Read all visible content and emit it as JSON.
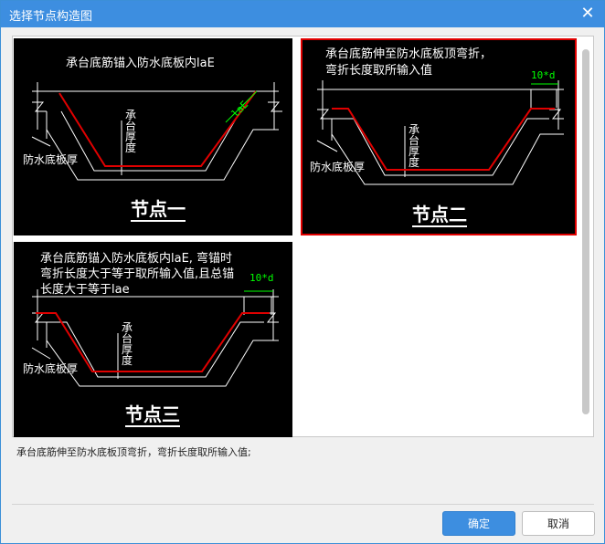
{
  "window": {
    "title": "选择节点构造图",
    "close_glyph": "✕"
  },
  "tiles": [
    {
      "caption_lines": [
        "承台底筋锚入防水底板内laE"
      ],
      "dim_label": "laE",
      "thickness_label": "承台厚度",
      "side_label": "防水底板厚",
      "node_label": "节点一",
      "selected": false
    },
    {
      "caption_lines": [
        "承台底筋伸至防水底板顶弯折，",
        "弯折长度取所输入值"
      ],
      "dim_label": "10*d",
      "thickness_label": "承台厚度",
      "side_label": "防水底板厚",
      "node_label": "节点二",
      "selected": true
    },
    {
      "caption_lines": [
        "承台底筋锚入防水底板内laE, 弯锚时",
        "弯折长度大于等于取所输入值,且总锚",
        "长度大于等于lae"
      ],
      "dim_label": "10*d",
      "thickness_label": "承台厚度",
      "side_label": "防水底板厚",
      "node_label": "节点三",
      "selected": false
    }
  ],
  "description": "承台底筋伸至防水底板顶弯折，弯折长度取所输入值;",
  "buttons": {
    "ok": "确定",
    "cancel": "取消"
  },
  "colors": {
    "accent": "#3d8ee0",
    "rebar": "#e00000",
    "dimension": "#00ff00",
    "selection": "#e00000"
  }
}
